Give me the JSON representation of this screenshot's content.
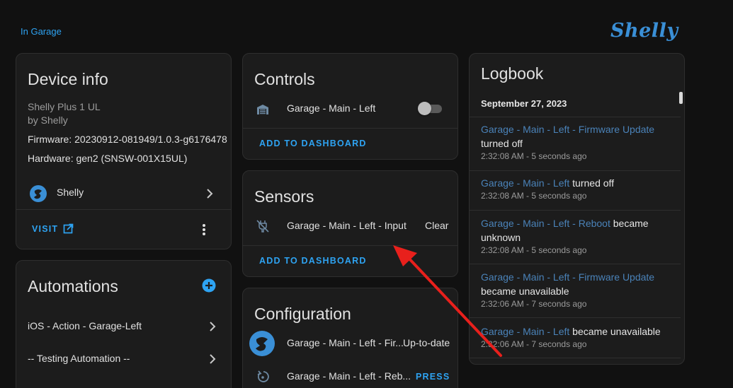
{
  "header": {
    "area_link": "In Garage",
    "brand_logo": "Shelly"
  },
  "device_info": {
    "title": "Device info",
    "model": "Shelly Plus 1 UL",
    "manufacturer": "by Shelly",
    "firmware": "Firmware: 20230912-081949/1.0.3-g6176478",
    "hardware": "Hardware: gen2 (SNSW-001X15UL)",
    "integration_name": "Shelly",
    "visit_label": "VISIT"
  },
  "automations": {
    "title": "Automations",
    "items": [
      {
        "label": "iOS - Action - Garage-Left"
      },
      {
        "label": "-- Testing Automation --"
      }
    ]
  },
  "controls": {
    "title": "Controls",
    "entity": "Garage - Main - Left",
    "toggle_state": "off",
    "add_label": "ADD TO DASHBOARD"
  },
  "sensors": {
    "title": "Sensors",
    "entity": "Garage - Main - Left - Input",
    "state": "Clear",
    "add_label": "ADD TO DASHBOARD"
  },
  "configuration": {
    "title": "Configuration",
    "items": [
      {
        "label": "Garage - Main - Left - Fir...",
        "state": "Up-to-date"
      },
      {
        "label": "Garage - Main - Left - Reb...",
        "state": "PRESS"
      }
    ]
  },
  "logbook": {
    "title": "Logbook",
    "date": "September 27, 2023",
    "entries": [
      {
        "link": "Garage - Main - Left - Firmware Update",
        "text": "turned off",
        "time": "2:32:08 AM - 5 seconds ago"
      },
      {
        "link": "Garage - Main - Left",
        "text": " turned off",
        "time": "2:32:08 AM - 5 seconds ago"
      },
      {
        "link": "Garage - Main - Left - Reboot",
        "text": " became unknown",
        "time": "2:32:08 AM - 5 seconds ago"
      },
      {
        "link": "Garage - Main - Left - Firmware Update",
        "text": "became unavailable",
        "time": "2:32:06 AM - 7 seconds ago"
      },
      {
        "link": "Garage - Main - Left",
        "text": " became unavailable",
        "time": "2:32:06 AM - 7 seconds ago"
      }
    ]
  },
  "colors": {
    "accent": "#2ea3f2",
    "background": "#111111",
    "card": "#1c1c1c",
    "annotation_arrow": "#e8201c"
  }
}
